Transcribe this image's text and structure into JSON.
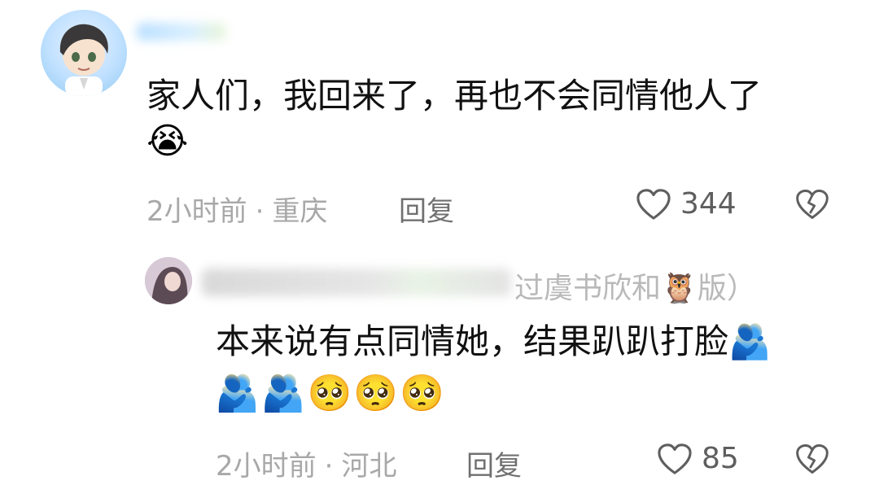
{
  "comments": [
    {
      "text": "家人们，我回来了，再也不会同情他人了",
      "emojis": "😭",
      "time": "2小时前",
      "separator": "·",
      "location": "重庆",
      "reply_label": "回复",
      "likes": "344"
    },
    {
      "author_suffix": "过虞书欣和🦉版）",
      "text": "本来说有点同情她，结果趴趴打脸🫂",
      "emojis": "🫂🫂🥺🥺🥺",
      "time": "2小时前",
      "separator": "·",
      "location": "河北",
      "reply_label": "回复",
      "likes": "85"
    }
  ],
  "icons": {
    "like": "heart-outline-icon",
    "dislike": "broken-heart-icon"
  },
  "colors": {
    "text": "#111111",
    "meta": "#a8a8a8",
    "icon": "#5e5e5e"
  }
}
